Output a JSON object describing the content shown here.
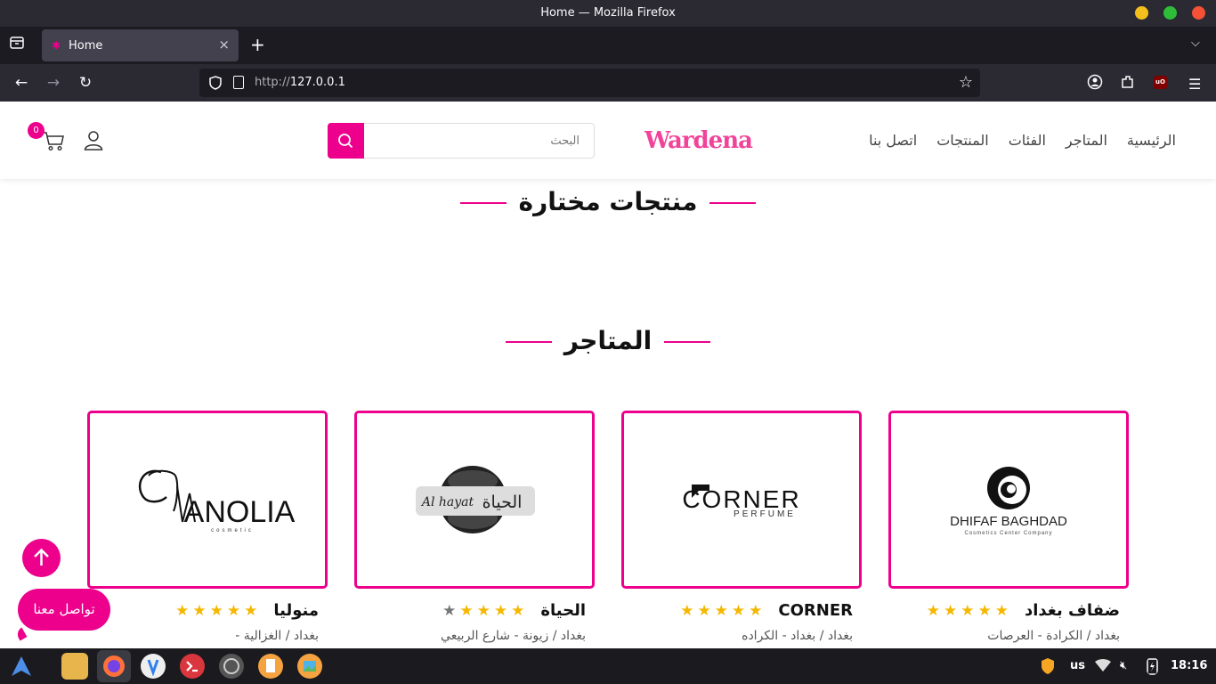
{
  "window": {
    "title": "Home — Mozilla Firefox"
  },
  "tabs": [
    {
      "label": "Home"
    }
  ],
  "toolbar": {
    "url_prefix": "http://",
    "url_host": "127.0.0.1"
  },
  "site": {
    "logo": "Wardena",
    "nav": [
      "الرئيسية",
      "المتاجر",
      "الفئات",
      "المنتجات",
      "اتصل بنا"
    ],
    "search_placeholder": "البحث",
    "cart_count": "0",
    "accent": "#ec008c"
  },
  "sections": {
    "featured_title": "منتجات مختارة",
    "stores_title": "المتاجر"
  },
  "stores": [
    {
      "name": "ضفاف بغداد",
      "location": "بغداد / الكرادة - العرصات",
      "rating": 5,
      "logo_text": "DHIFAF BAGHDAD",
      "logo_sub": "Cosmetics Center Company"
    },
    {
      "name": "CORNER",
      "location": "بغداد / بغداد - الكراده",
      "rating": 5,
      "logo_text": "CORNER",
      "logo_sub": "PERFUME"
    },
    {
      "name": "الحياة",
      "location": "بغداد / زيونة - شارع الربيعي",
      "rating": 4,
      "logo_text": "Al hayat",
      "logo_sub": "الحياة"
    },
    {
      "name": "منوليا",
      "location": "بغداد / الغزالية -",
      "rating": 5,
      "logo_text": "ANOLIA",
      "logo_sub": "cosmetic"
    }
  ],
  "floating": {
    "contact_label": "تواصل معنا"
  },
  "taskbar": {
    "keyboard": "us",
    "clock": "18:16"
  }
}
